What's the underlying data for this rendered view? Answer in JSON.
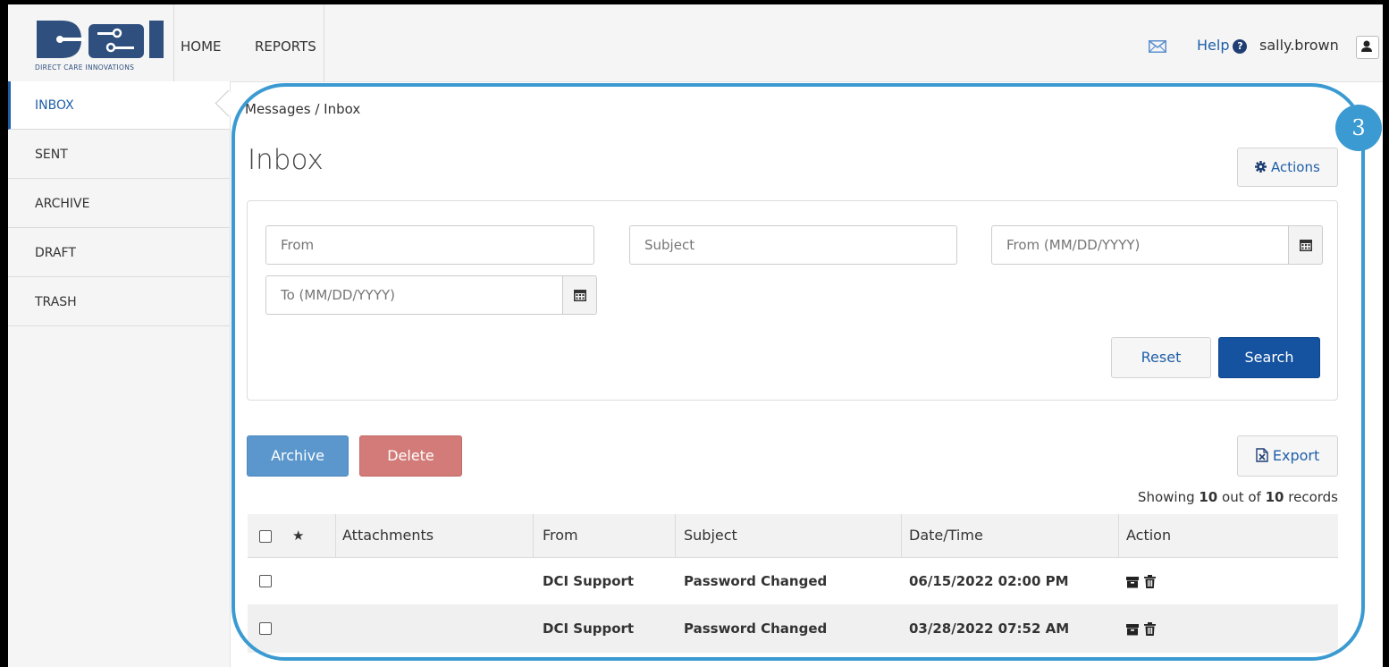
{
  "app": {
    "logo_caption": "DIRECT CARE INNOVATIONS",
    "nav": [
      "HOME",
      "REPORTS"
    ],
    "help_label": "Help",
    "username": "sally.brown"
  },
  "sidebar": {
    "items": [
      {
        "label": "INBOX",
        "active": true
      },
      {
        "label": "SENT",
        "active": false
      },
      {
        "label": "ARCHIVE",
        "active": false
      },
      {
        "label": "DRAFT",
        "active": false
      },
      {
        "label": "TRASH",
        "active": false
      }
    ]
  },
  "main": {
    "breadcrumb": "Messages / Inbox",
    "title": "Inbox",
    "actions_label": "Actions"
  },
  "filters": {
    "from_placeholder": "From",
    "subject_placeholder": "Subject",
    "date_from_placeholder": "From (MM/DD/YYYY)",
    "date_to_placeholder": "To (MM/DD/YYYY)",
    "reset_label": "Reset",
    "search_label": "Search"
  },
  "toolbar": {
    "archive_label": "Archive",
    "delete_label": "Delete",
    "export_label": "Export",
    "showing_prefix": "Showing",
    "showing_count": "10",
    "showing_mid": "out of",
    "showing_total": "10",
    "showing_suffix": "records"
  },
  "table": {
    "headers": [
      "★",
      "Attachments",
      "From",
      "Subject",
      "Date/Time",
      "Action"
    ],
    "rows": [
      {
        "from": "DCI Support",
        "subject": "Password Changed",
        "datetime": "06/15/2022 02:00 PM"
      },
      {
        "from": "DCI Support",
        "subject": "Password Changed",
        "datetime": "03/28/2022 07:52 AM"
      }
    ]
  },
  "annotation": {
    "step_number": "3",
    "color": "#3a9ad1"
  },
  "colors": {
    "primary": "#1552a0",
    "archive": "#5b97cc",
    "delete": "#d27b78",
    "link": "#1f5fa8"
  }
}
